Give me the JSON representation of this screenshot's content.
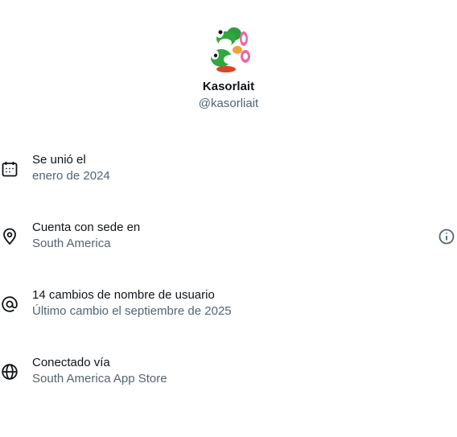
{
  "profile": {
    "display_name": "Kasorlait",
    "handle": "@kasorliait",
    "avatar_icon": "yoshi-avatar"
  },
  "about": [
    {
      "icon": "calendar-icon",
      "title": "Se unió el",
      "value": "enero de 2024"
    },
    {
      "icon": "location-pin-icon",
      "title": "Cuenta con sede en",
      "value": "South America",
      "info_icon": "info-circle-icon"
    },
    {
      "icon": "at-sign-icon",
      "title": "14 cambios de nombre de usuario",
      "value": "Último cambio el septiembre de 2025"
    },
    {
      "icon": "globe-icon",
      "title": "Conectado vía",
      "value": "South America App Store"
    }
  ],
  "colors": {
    "primary_text": "#0f1419",
    "secondary_text": "#536471"
  }
}
